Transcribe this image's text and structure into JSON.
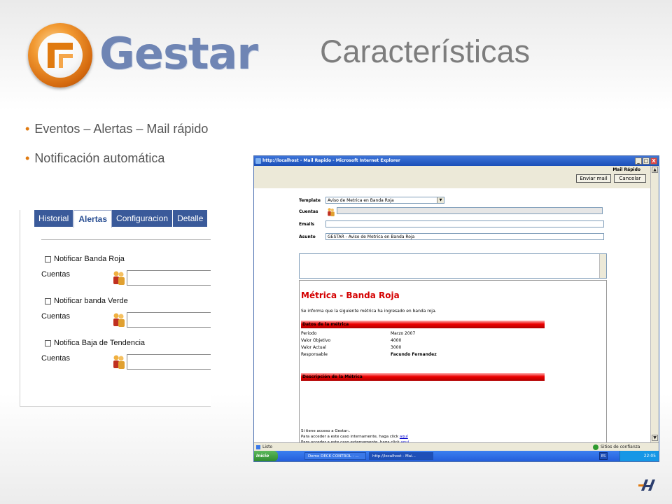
{
  "header": {
    "logo_text": "Gestar",
    "title": "Características"
  },
  "bullets": [
    "Eventos – Alertas – Mail rápido",
    "Notificación automática"
  ],
  "left_panel": {
    "tabs": [
      "Historial",
      "Alertas",
      "Configuracion",
      "Detalle"
    ],
    "active_tab": "Alertas",
    "alerts": [
      {
        "checkbox_label": "Notificar Banda Roja",
        "field_label": "Cuentas",
        "checked": false
      },
      {
        "checkbox_label": "Notificar banda Verde",
        "field_label": "Cuentas",
        "checked": false
      },
      {
        "checkbox_label": "Notifica Baja de Tendencia",
        "field_label": "Cuentas",
        "checked": false
      }
    ]
  },
  "browser": {
    "title": "http://localhost - Mail Rapido - Microsoft Internet Explorer",
    "window_buttons": [
      "_",
      "□",
      "X"
    ],
    "section_title": "Mail Rápido",
    "send_button": "Enviar mail",
    "cancel_button": "Cancelar",
    "form": {
      "template_label": "Template",
      "template_value": "Aviso de Metrica en Banda Roja",
      "cuentas_label": "Cuentas",
      "cuentas_value": "",
      "emails_label": "Emails",
      "emails_value": "",
      "asunto_label": "Asunto",
      "asunto_value": "GESTAR - Aviso de Metrica en Banda Roja"
    },
    "message": {
      "title": "Métrica - Banda Roja",
      "intro": "Se informa que la siguiente métrica ha ingresado en banda roja.",
      "data_header": "Datos de la métrica",
      "rows": [
        {
          "label": "Periodo",
          "value": "Marzo 2007"
        },
        {
          "label": "Valor Objetivo",
          "value": "4000"
        },
        {
          "label": "Valor Actual",
          "value": "3000"
        },
        {
          "label": "Responsable",
          "value": "Facundo Fernandez"
        }
      ],
      "desc_header": "Descripción de la Métrica",
      "footer": [
        {
          "text": "Si tiene acceso a Gestar:.",
          "link": ""
        },
        {
          "text": "Para acceder a este caso internamente, haga click ",
          "link": "aquí"
        },
        {
          "text": "Para acceder a este caso externamente, haga click ",
          "link": "aquí"
        }
      ]
    },
    "status_text": "Listo",
    "zone_text": "Sitios de confianza"
  },
  "taskbar": {
    "start": "Inicio",
    "tasks": [
      "Demo DECK CONTROL - ...",
      "http://localhost - Mai..."
    ],
    "lang": "ES",
    "clock": "22:05"
  },
  "colors": {
    "accent_orange": "#e07a10",
    "logo_blue": "#6f85b4",
    "tab_blue": "#3a5a9a",
    "alert_red": "#d40000"
  }
}
